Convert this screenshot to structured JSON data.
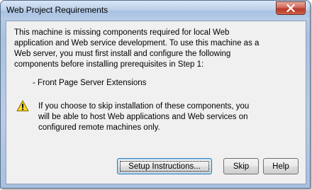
{
  "window": {
    "title": "Web Project Requirements"
  },
  "message": {
    "body": "This machine is missing components required for local Web\napplication and Web service development. To use this machine as a\nWeb server, you must first install and configure the following\ncomponents before installing prerequisites in Step 1:",
    "components": [
      "- Front Page Server Extensions"
    ],
    "warning": "If you choose to skip installation of these components, you\nwill be able to host Web applications and Web services on\nconfigured remote machines only."
  },
  "buttons": {
    "setup_instructions": "Setup Instructions...",
    "skip": "Skip",
    "help": "Help"
  },
  "icons": {
    "close": "close-icon",
    "warning": "warning-icon"
  },
  "colors": {
    "warning_fill": "#f7d72e",
    "close_button": "#c4483a"
  }
}
